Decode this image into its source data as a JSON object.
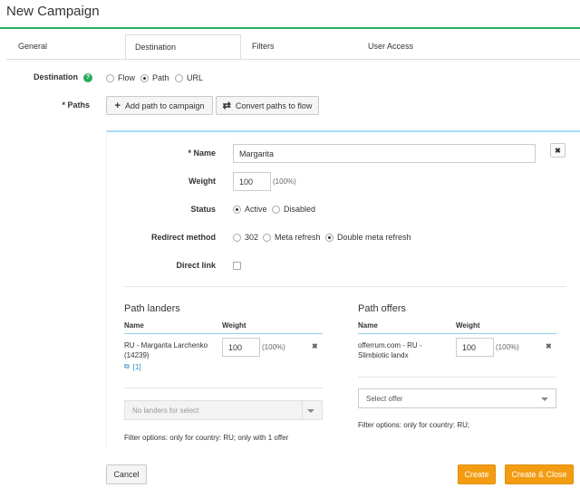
{
  "title": "New Campaign",
  "tabs": [
    {
      "label": "General"
    },
    {
      "label": "Destination",
      "active": true
    },
    {
      "label": "Filters"
    },
    {
      "label": "User Access"
    }
  ],
  "destination": {
    "label": "Destination",
    "help_icon": "question-circle-icon",
    "options": [
      {
        "label": "Flow",
        "selected": false
      },
      {
        "label": "Path",
        "selected": true
      },
      {
        "label": "URL",
        "selected": false
      }
    ]
  },
  "paths": {
    "label": "* Paths",
    "add_button": "Add path to campaign",
    "add_icon": "plus-icon",
    "convert_button": "Convert paths to flow",
    "convert_icon": "exchange-icon"
  },
  "path": {
    "name_label": "* Name",
    "name_value": "Margarita",
    "remove_icon": "close-icon",
    "weight_label": "Weight",
    "weight_value": "100",
    "weight_pct": "(100%)",
    "status_label": "Status",
    "status_options": [
      {
        "label": "Active",
        "selected": true
      },
      {
        "label": "Disabled",
        "selected": false
      }
    ],
    "redirect_label": "Redirect method",
    "redirect_options": [
      {
        "label": "302",
        "selected": false
      },
      {
        "label": "Meta refresh",
        "selected": false
      },
      {
        "label": "Double meta refresh",
        "selected": true
      }
    ],
    "direct_link_label": "Direct link",
    "direct_link_checked": false
  },
  "landers": {
    "title": "Path landers",
    "col_name": "Name",
    "col_weight": "Weight",
    "rows": [
      {
        "name_line1": "RU - Margarita Larchenko",
        "name_line2": "(14239)",
        "link_icon": "external-link-icon",
        "badge": "[1]",
        "weight": "100",
        "pct": "(100%)",
        "remove_icon": "remove-icon"
      }
    ],
    "select_placeholder": "No landers for select",
    "filter_text": "Filter options: only for country: RU; only with 1 offer"
  },
  "offers": {
    "title": "Path offers",
    "col_name": "Name",
    "col_weight": "Weight",
    "rows": [
      {
        "name_line1": "offerrum.com - RU -",
        "name_line2": "Slimbiotic landx",
        "weight": "100",
        "pct": "(100%)",
        "remove_icon": "remove-icon"
      }
    ],
    "select_placeholder": "Select offer",
    "filter_text": "Filter options: only for country: RU;"
  },
  "footer": {
    "cancel": "Cancel",
    "create": "Create",
    "create_close": "Create & Close"
  },
  "colors": {
    "accent_green": "#27ae60",
    "panel_border_blue": "#a6dcf2",
    "primary_orange": "#f39c12"
  }
}
